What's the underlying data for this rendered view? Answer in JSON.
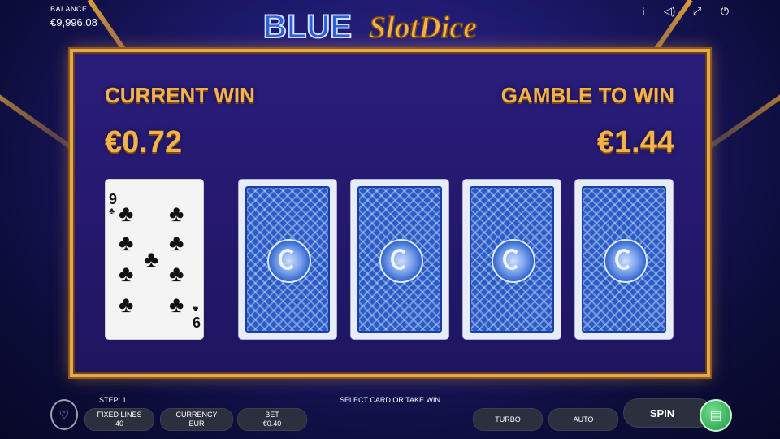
{
  "balance": {
    "label": "BALANCE",
    "value": "€9,996.08"
  },
  "logo": {
    "text_blue": "BLUE",
    "text_gold": "SlotDice"
  },
  "top_icons": [
    "info-icon",
    "sound-icon",
    "fullscreen-icon",
    "power-icon"
  ],
  "top_icon_glyphs": {
    "info": "i",
    "sound": "◁)",
    "fullscreen": "⤢",
    "power": "⏻"
  },
  "gamble": {
    "current_win_label": "CURRENT WIN",
    "current_win_value": "€0.72",
    "gamble_label": "GAMBLE TO WIN",
    "gamble_value": "€1.44",
    "face_card": {
      "rank": "9",
      "suit": "♣"
    },
    "hidden_cards": 4
  },
  "bottom": {
    "step": "STEP: 1",
    "status": "SELECT CARD OR TAKE WIN",
    "fixed_lines_label": "FIXED LINES",
    "fixed_lines_value": "40",
    "currency_label": "CURRENCY",
    "currency_value": "EUR",
    "bet_label": "BET",
    "bet_value": "€0.40",
    "turbo": "TURBO",
    "auto": "AUTO",
    "spin": "SPIN"
  },
  "colors": {
    "gold": "#f3b34a",
    "frame": "#e6a84a",
    "card_back": "#2a5cc8",
    "spin_coin": "#2fb85a"
  }
}
